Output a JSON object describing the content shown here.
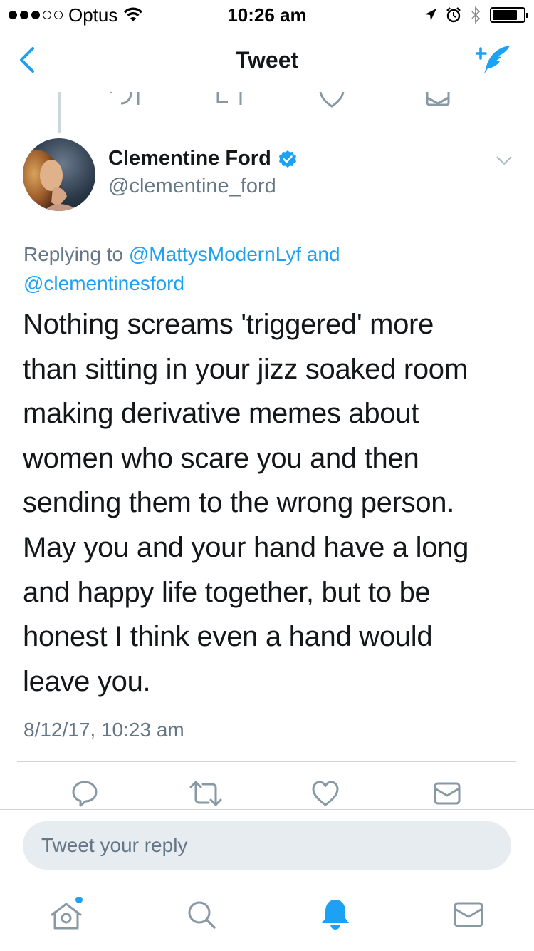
{
  "status_bar": {
    "carrier": "Optus",
    "signal_filled": 3,
    "signal_total": 5,
    "time": "10:26 am",
    "battery_level": 0.8
  },
  "nav": {
    "title": "Tweet",
    "back_icon": "chevron-left-icon",
    "compose_icon": "compose-tweet-icon"
  },
  "tweet": {
    "author_name": "Clementine Ford",
    "author_handle": "@clementine_ford",
    "verified": true,
    "replying_prefix": "Replying to",
    "replying_user1": "@MattysModernLyf",
    "replying_conj": "and",
    "replying_user2": "@clementinesford",
    "text_lines": [
      "Nothing screams 'triggered' more",
      "than sitting in your jizz soaked room",
      "making derivative memes about",
      "women who scare you and then",
      "sending them to the wrong person.",
      "May you and your hand have a long",
      "and happy life together, but to be",
      "honest I think even a hand would",
      "leave you."
    ],
    "timestamp": "8/12/17, 10:23 am"
  },
  "actions": [
    "reply-icon",
    "retweet-icon",
    "like-icon",
    "direct-message-icon"
  ],
  "reply_box": {
    "placeholder": "Tweet your reply"
  },
  "tab_bar": {
    "items": [
      "home-icon",
      "search-icon",
      "notifications-icon",
      "messages-icon"
    ],
    "active": "notifications-icon"
  },
  "colors": {
    "accent": "#1da1f2",
    "text": "#14171a",
    "muted": "#657786",
    "input_bg": "#e6ecf0"
  }
}
